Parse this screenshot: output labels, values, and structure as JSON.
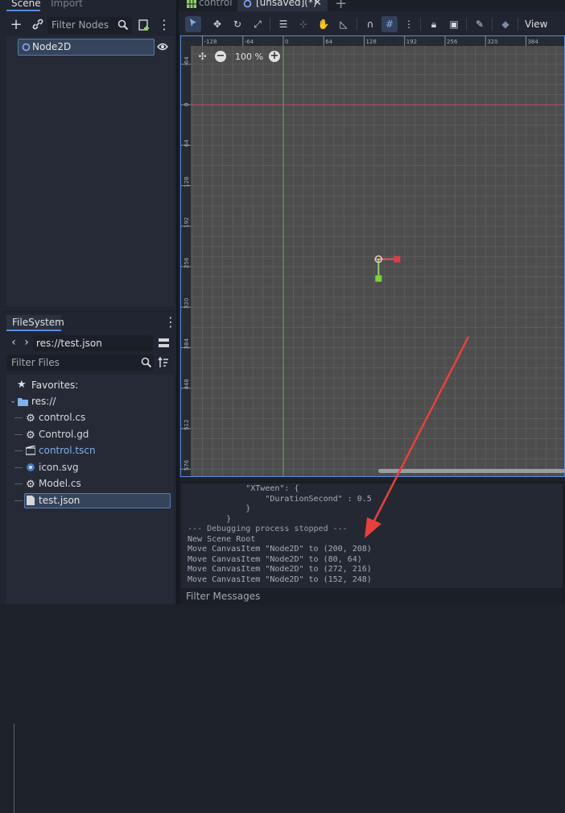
{
  "scene_dock": {
    "tabs": [
      "Scene",
      "Import"
    ],
    "filter_placeholder": "Filter Nodes",
    "root_node": "Node2D"
  },
  "filesystem_dock": {
    "tab": "FileSystem",
    "path": "res://test.json",
    "filter_placeholder": "Filter Files",
    "favorites_label": "Favorites:",
    "root_folder": "res://",
    "files": [
      {
        "name": "control.cs",
        "icon": "gear-icon",
        "color": "#d4d6d9"
      },
      {
        "name": "Control.gd",
        "icon": "gear-icon",
        "color": "#d4d6d9"
      },
      {
        "name": "control.tscn",
        "icon": "clapperboard-icon",
        "color": "#7fb0ea"
      },
      {
        "name": "icon.svg",
        "icon": "image-icon",
        "color": "#d4d6d9"
      },
      {
        "name": "Model.cs",
        "icon": "gear-icon",
        "color": "#d4d6d9"
      },
      {
        "name": "test.json",
        "icon": "file-icon",
        "color": "#e6e7e9"
      }
    ]
  },
  "editor_tabs": [
    {
      "label": "control"
    },
    {
      "label": "[unsaved](*)"
    }
  ],
  "viewport": {
    "view_menu": "View",
    "zoom": "100 %",
    "h_ruler": [
      "-128",
      "-64",
      "0",
      "64",
      "128",
      "192",
      "256",
      "320",
      "384"
    ],
    "v_ruler": [
      "-64",
      "0",
      "64",
      "128",
      "192",
      "256",
      "320",
      "384",
      "448",
      "512",
      "576"
    ]
  },
  "output": {
    "lines": [
      "            \"XTween\": {",
      "                \"DurationSecond\" : 0.5",
      "            }",
      "        }",
      "--- Debugging process stopped ---",
      "New Scene Root",
      "Move CanvasItem \"Node2D\" to (200, 208)",
      "Move CanvasItem \"Node2D\" to (80, 64)",
      "Move CanvasItem \"Node2D\" to (272, 216)",
      "Move CanvasItem \"Node2D\" to (152, 248)"
    ],
    "filter_placeholder": "Filter Messages"
  },
  "colors": {
    "accent": "#5a8ce0",
    "annotation_arrow": "#e8413c",
    "canvas_bg": "#4d4d4d"
  }
}
